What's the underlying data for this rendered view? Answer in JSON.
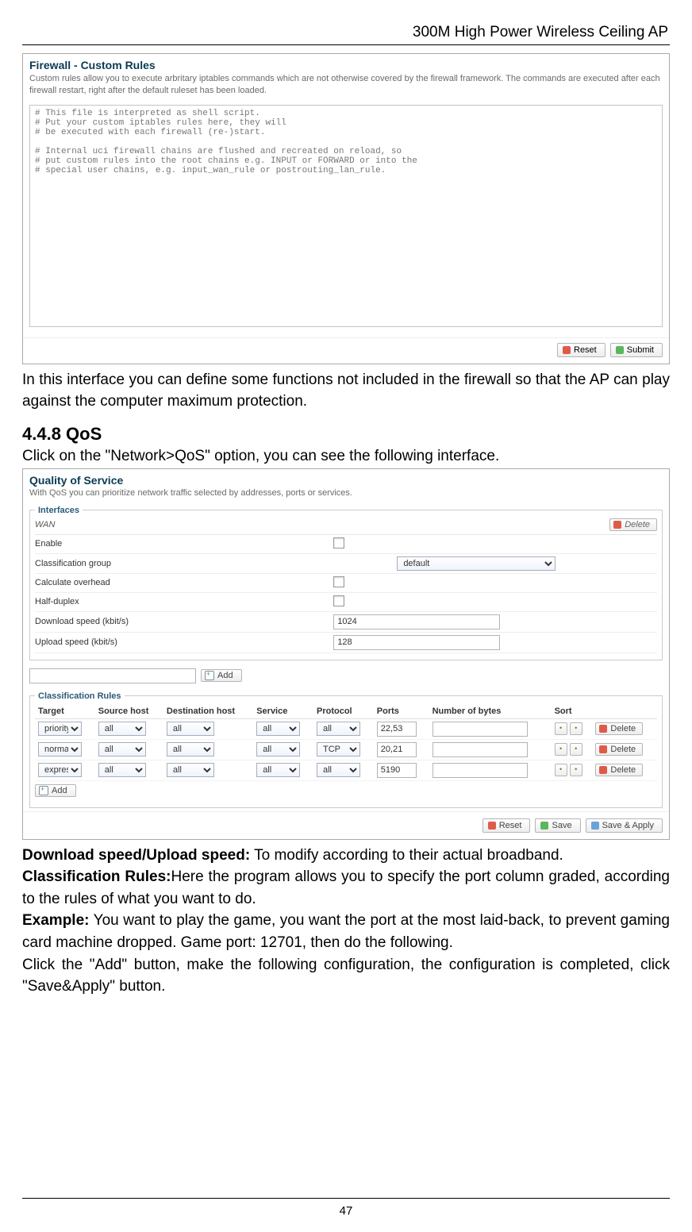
{
  "doc": {
    "header_title": "300M High Power Wireless Ceiling AP",
    "page_number": "47",
    "para_interface": "In this interface you can define some functions not included in the firewall so that the AP can play against the computer maximum protection.",
    "section_heading": "4.4.8 QoS",
    "section_intro": "Click on the \"Network>QoS\" option, you can see the following interface.",
    "desc_download_speed_lbl": "Download speed/Upload speed:",
    "desc_download_speed_txt": " To modify according to their actual broadband.",
    "desc_classification_lbl": "Classification Rules:",
    "desc_classification_txt": "Here the program allows you to specify the port column graded, according to the rules of what you want to do.",
    "desc_example_lbl": "Example:",
    "desc_example_txt": " You want to play the game, you want the port at the most laid-back, to prevent gaming card machine dropped. Game port: 12701, then do the following.",
    "desc_add_txt": "Click the \"Add\" button, make the following configuration, the configuration is completed, click \"Save&Apply\" button."
  },
  "firewall": {
    "title": "Firewall - Custom Rules",
    "description": "Custom rules allow you to execute arbritary iptables commands which are not otherwise covered by the firewall framework. The commands are executed after each firewall restart, right after the default ruleset has been loaded.",
    "code": "# This file is interpreted as shell script.\n# Put your custom iptables rules here, they will\n# be executed with each firewall (re-)start.\n\n# Internal uci firewall chains are flushed and recreated on reload, so\n# put custom rules into the root chains e.g. INPUT or FORWARD or into the\n# special user chains, e.g. input_wan_rule or postrouting_lan_rule.",
    "reset_btn": "Reset",
    "submit_btn": "Submit"
  },
  "qos": {
    "title": "Quality of Service",
    "description": "With QoS you can prioritize network traffic selected by addresses, ports or services.",
    "group_interfaces": "Interfaces",
    "wan_label": "WAN",
    "delete_btn": "Delete",
    "fields": {
      "enable": "Enable",
      "class_group": "Classification group",
      "class_group_value": "default",
      "calc_overhead": "Calculate overhead",
      "half_duplex": "Half-duplex",
      "download_speed": "Download speed (kbit/s)",
      "download_value": "1024",
      "upload_speed": "Upload speed (kbit/s)",
      "upload_value": "128"
    },
    "add_btn": "Add",
    "group_classification": "Classification Rules",
    "table": {
      "headers": [
        "Target",
        "Source host",
        "Destination host",
        "Service",
        "Protocol",
        "Ports",
        "Number of bytes",
        "Sort",
        ""
      ],
      "rows": [
        {
          "target": "priority",
          "src": "all",
          "dst": "all",
          "service": "all",
          "proto": "all",
          "ports": "22,53",
          "bytes": "",
          "del": "Delete"
        },
        {
          "target": "normal",
          "src": "all",
          "dst": "all",
          "service": "all",
          "proto": "TCP",
          "ports": "20,21",
          "bytes": "",
          "del": "Delete"
        },
        {
          "target": "expres",
          "src": "all",
          "dst": "all",
          "service": "all",
          "proto": "all",
          "ports": "5190",
          "bytes": "",
          "del": "Delete"
        }
      ]
    },
    "reset_btn": "Reset",
    "save_btn": "Save",
    "save_apply_btn": "Save & Apply"
  }
}
